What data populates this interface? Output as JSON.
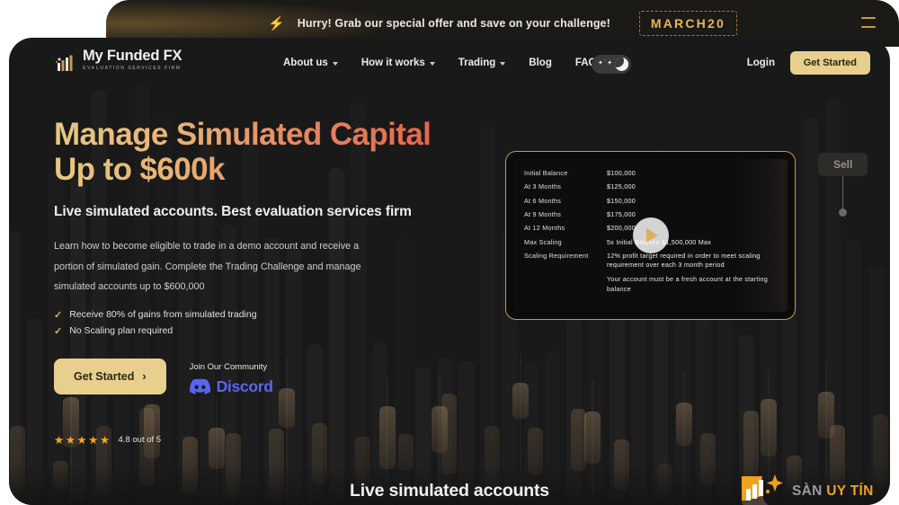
{
  "promo": {
    "icon": "bolt-icon",
    "text": "Hurry! Grab our special offer and save on your challenge!",
    "code": "MARCH20",
    "menu_icon": "hamburger-menu-icon"
  },
  "nav": {
    "logo_title": "My Funded FX",
    "logo_subtitle": "EVALUATION SERVICES FIRM",
    "links": [
      {
        "label": "About us",
        "has_dropdown": true
      },
      {
        "label": "How it works",
        "has_dropdown": true
      },
      {
        "label": "Trading",
        "has_dropdown": true
      },
      {
        "label": "Blog",
        "has_dropdown": false
      },
      {
        "label": "FAQ",
        "has_dropdown": false
      }
    ],
    "theme_toggle_icon": "moon-stars-icon",
    "login_label": "Login",
    "get_started_label": "Get Started"
  },
  "hero": {
    "headline": "Manage Simulated Capital Up to $600k",
    "subheadline": "Live simulated accounts. Best evaluation services firm",
    "body": "Learn how to become eligible to trade in a demo account and receive a portion of simulated gain. Complete the Trading Challenge and manage simulated accounts up to $600,000",
    "bullets": [
      "Receive 80% of gains from simulated trading",
      "No Scaling plan required"
    ],
    "cta_label": "Get Started",
    "cta_arrow": "chevron-right-icon",
    "community_label": "Join Our Community",
    "discord_label": "Discord",
    "stars": "★★★★★",
    "rating_text": "4.8 out of 5",
    "accent_gold": "#e9cf8e",
    "accent_coral": "#e2654b",
    "discord_color": "#5865f2"
  },
  "video_card": {
    "rows": [
      {
        "key": "Initial Balance",
        "value": "$100,000"
      },
      {
        "key": "At 3 Months",
        "value": "$125,000"
      },
      {
        "key": "At 6 Months",
        "value": "$150,000"
      },
      {
        "key": "At 9 Months",
        "value": "$175,000"
      },
      {
        "key": "At 12 Months",
        "value": "$200,000"
      },
      {
        "key": "Max Scaling",
        "value": "5x Initial Balance $1,500,000 Max"
      },
      {
        "key": "Scaling Requirement",
        "value": "12% profit target required in order to meet scaling requirement over each 3 month period"
      }
    ],
    "note": "Your account must be a fresh account at the starting balance",
    "play_icon": "play-icon",
    "border_color": "#c79a46"
  },
  "chart_marker": {
    "label": "Sell"
  },
  "watermark": {
    "text_primary": "SÀN",
    "text_secondary": "UY TÍN",
    "color_primary": "#9b9b9b",
    "color_secondary": "#f0a21b"
  },
  "bottom": {
    "heading": "Live simulated accounts"
  }
}
